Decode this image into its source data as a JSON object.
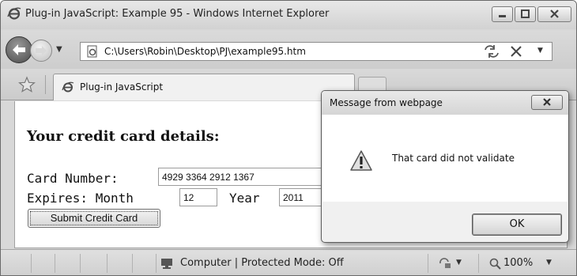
{
  "window": {
    "title": "Plug-in JavaScript: Example 95 - Windows Internet Explorer"
  },
  "address_bar": {
    "url": "C:\\Users\\Robin\\Desktop\\PJ\\example95.htm"
  },
  "tabs": [
    {
      "label": "Plug-in JavaScript"
    }
  ],
  "page": {
    "heading": "Your credit card details:",
    "card_number_label": "Card Number:",
    "card_number_value": "4929 3364 2912 1367",
    "expires_label": "Expires: Month",
    "month_value": "12",
    "year_label": "Year",
    "year_value": "2011",
    "submit_label": "Submit Credit Card"
  },
  "status_bar": {
    "zone_text": "Computer | Protected Mode: Off",
    "zoom": "100%"
  },
  "dialog": {
    "title": "Message from webpage",
    "message": "That card did not validate",
    "ok_label": "OK"
  },
  "icons": {
    "browser": "ie-logo-icon",
    "back": "back-arrow-icon",
    "forward": "forward-arrow-icon",
    "refresh": "refresh-icon",
    "stop": "stop-icon",
    "favorites": "star-icon",
    "warning": "warning-icon",
    "zone": "computer-icon",
    "zoom": "magnifier-icon"
  }
}
